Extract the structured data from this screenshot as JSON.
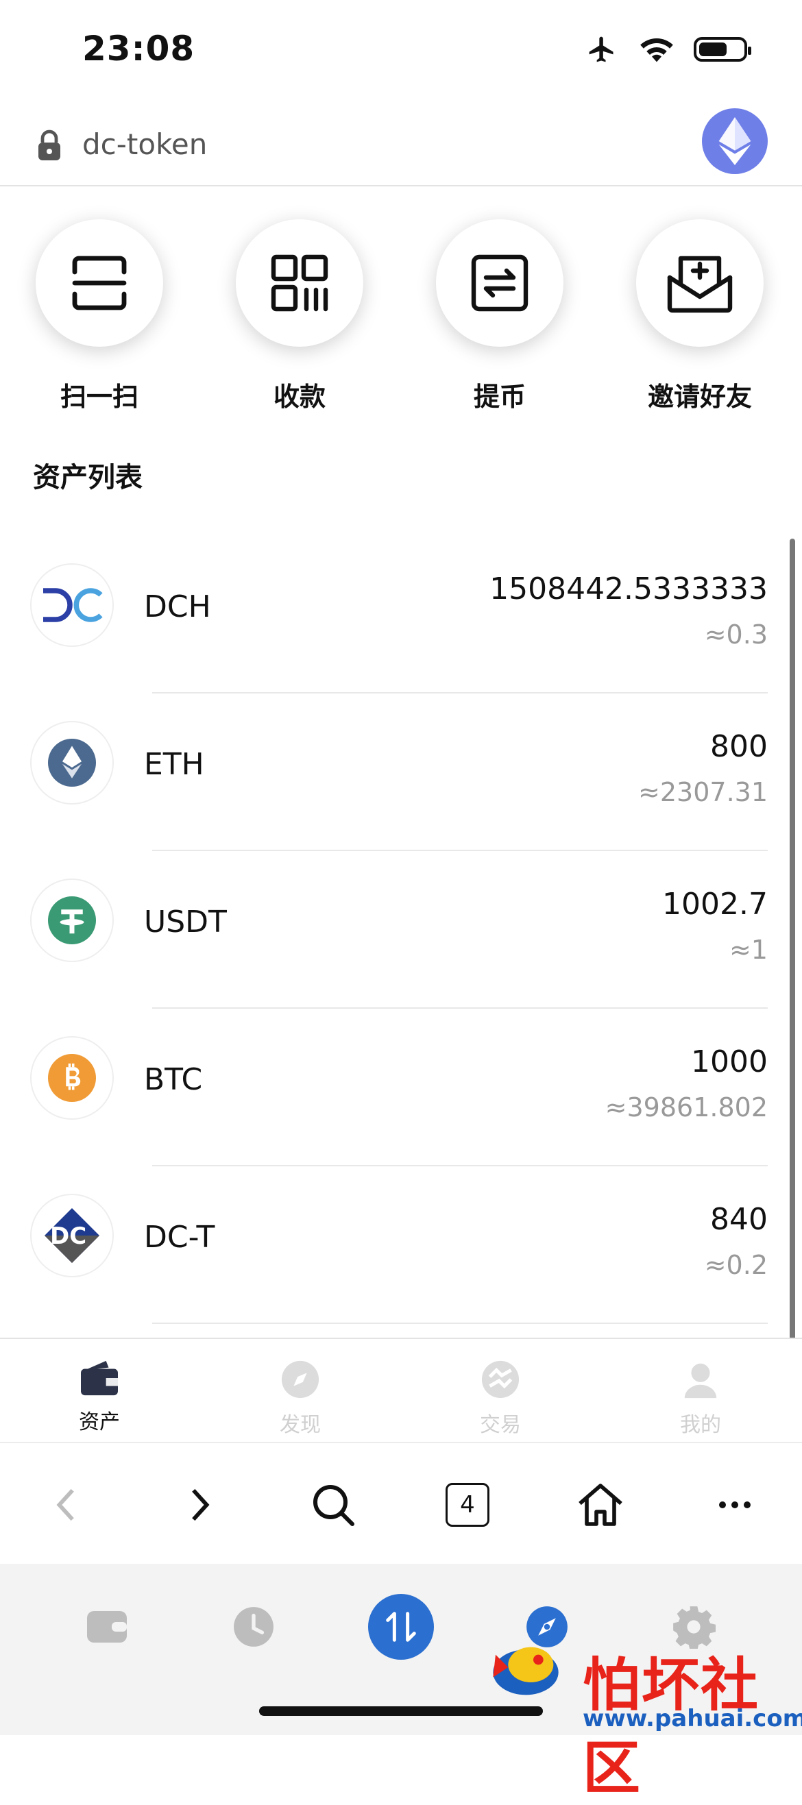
{
  "status_bar": {
    "time": "23:08"
  },
  "url_bar": {
    "url": "dc-token"
  },
  "quick_actions": [
    {
      "label": "扫一扫",
      "icon": "scan-icon"
    },
    {
      "label": "收款",
      "icon": "qr-code-icon"
    },
    {
      "label": "提币",
      "icon": "transfer-icon"
    },
    {
      "label": "邀请好友",
      "icon": "invite-envelope-icon"
    }
  ],
  "assets": {
    "title": "资产列表",
    "items": [
      {
        "symbol": "DCH",
        "amount": "1508442.5333333",
        "value": "≈0.3",
        "icon": "dch-coin-icon"
      },
      {
        "symbol": "ETH",
        "amount": "800",
        "value": "≈2307.31",
        "icon": "eth-coin-icon"
      },
      {
        "symbol": "USDT",
        "amount": "1002.7",
        "value": "≈1",
        "icon": "usdt-coin-icon"
      },
      {
        "symbol": "BTC",
        "amount": "1000",
        "value": "≈39861.802",
        "icon": "btc-coin-icon"
      },
      {
        "symbol": "DC-T",
        "amount": "840",
        "value": "≈0.2",
        "icon": "dct-coin-icon"
      }
    ]
  },
  "app_tabs": [
    {
      "label": "资产",
      "icon": "wallet-icon",
      "active": true
    },
    {
      "label": "发现",
      "icon": "compass-icon",
      "active": false
    },
    {
      "label": "交易",
      "icon": "exchange-icon",
      "active": false
    },
    {
      "label": "我的",
      "icon": "user-icon",
      "active": false
    }
  ],
  "browser_bar": {
    "tab_count": "4"
  },
  "colors": {
    "accent": "#2b6fd0",
    "eth_avatar": "#6f7fe8",
    "btc": "#f09b35",
    "usdt": "#3a9a74",
    "eth": "#4c6a8f"
  },
  "watermark": {
    "title": "怕坏社区",
    "url": "www.pahuai.com"
  }
}
